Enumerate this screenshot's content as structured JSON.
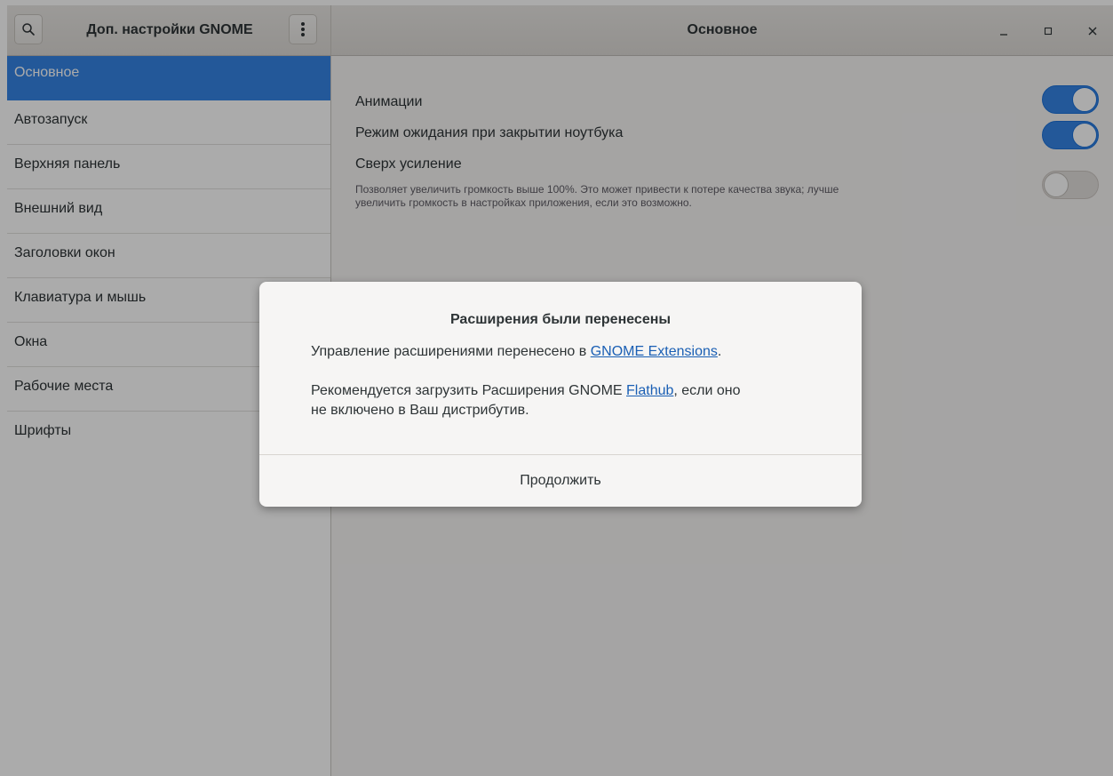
{
  "header": {
    "app_title": "Доп. настройки GNOME",
    "page_title": "Основное",
    "search_icon": "search-icon",
    "menu_icon": "vertical-dots-icon",
    "window_controls": {
      "minimize": "_",
      "maximize": "□",
      "close": "✕"
    }
  },
  "sidebar": {
    "items": [
      {
        "label": "Основное",
        "selected": true
      },
      {
        "label": "Автозапуск"
      },
      {
        "label": "Верхняя панель"
      },
      {
        "label": "Внешний вид"
      },
      {
        "label": "Заголовки окон"
      },
      {
        "label": "Клавиатура и мышь"
      },
      {
        "label": "Окна"
      },
      {
        "label": "Рабочие места"
      },
      {
        "label": "Шрифты"
      }
    ]
  },
  "main": {
    "settings": [
      {
        "label": "Анимации",
        "enabled": true
      },
      {
        "label": "Режим ожидания при закрытии ноутбука",
        "enabled": true
      },
      {
        "label": "Сверх усиление",
        "enabled": false,
        "description_line1": "Позволяет увеличить громкость выше 100%. Это может привести к потере качества звука; лучше",
        "description_line2": "увеличить громкость в настройках приложения, если это возможно."
      }
    ]
  },
  "dialog": {
    "title": "Расширения были перенесены",
    "text1_before": "Управление расширениями перенесено в ",
    "text1_link": "GNOME Extensions",
    "text1_after": ".",
    "text2_before": "Рекомендуется загрузить Расширения GNOME ",
    "text2_link": "Flathub",
    "text2_after": ", если оно",
    "text2_line2": "не включено в Ваш дистрибутив.",
    "button_label": "Продолжить"
  },
  "colors": {
    "accent": "#3584e4",
    "link": "#1a5fb4"
  }
}
